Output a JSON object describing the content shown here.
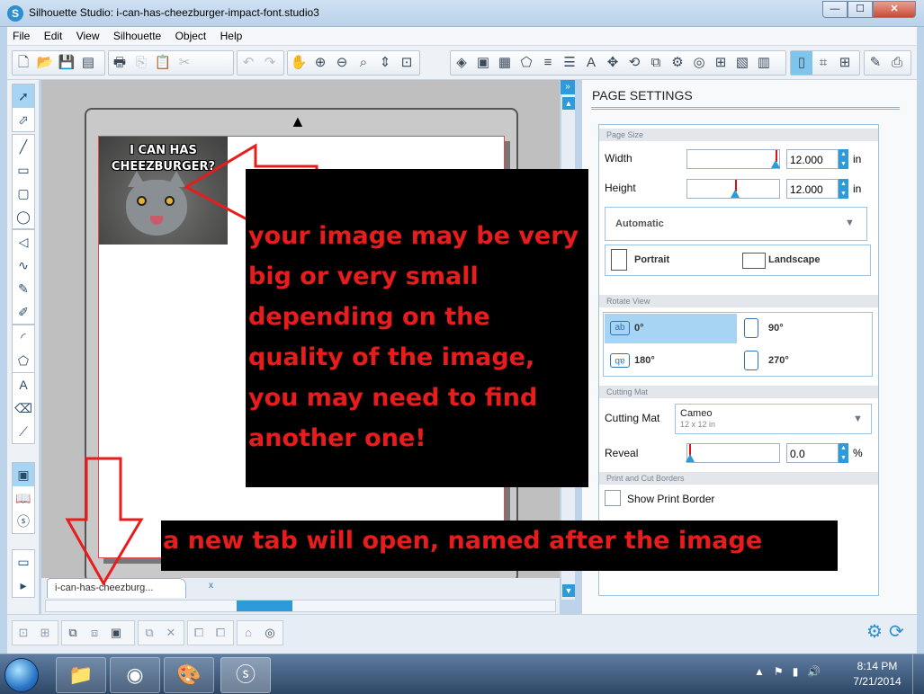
{
  "window": {
    "title": "Silhouette Studio: i-can-has-cheezburger-impact-font.studio3",
    "app_icon_letter": "S",
    "min_label": "—",
    "max_label": "☐",
    "close_label": "✕"
  },
  "menu": [
    "File",
    "Edit",
    "View",
    "Silhouette",
    "Object",
    "Help"
  ],
  "canvas": {
    "meme_text_line1": "I CAN HAS",
    "meme_text_line2": "CHEEZBURGER?"
  },
  "tab": {
    "label": "i-can-has-cheezburg...",
    "close": "x"
  },
  "panel": {
    "collapse_label": "»",
    "title": "PAGE SETTINGS",
    "page_size_head": "Page Size",
    "width_label": "Width",
    "width_value": "12.000",
    "width_unit": "in",
    "height_label": "Height",
    "height_value": "12.000",
    "height_unit": "in",
    "size_dropdown": "Automatic",
    "portrait": "Portrait",
    "landscape": "Landscape",
    "rotate_head": "Rotate View",
    "rotations": [
      "0°",
      "90°",
      "180°",
      "270°"
    ],
    "rotation_glyph": "ab",
    "cutting_mat_head": "Cutting Mat",
    "cutting_mat_label": "Cutting Mat",
    "cutting_mat_value": "Cameo",
    "cutting_mat_size": "12 x 12 in",
    "reveal_label": "Reveal",
    "reveal_value": "0.0",
    "reveal_unit": "%",
    "print_cut_head": "Print and Cut Borders",
    "show_print_border": "Show Print Border"
  },
  "annotations": {
    "image_note_lines": [
      "your image may be very",
      "big or very small",
      "depending on the",
      "quality of the image,",
      "you may need to find",
      "another one!"
    ],
    "tab_note": "a new tab will open, named after the image"
  },
  "taskbar": {
    "time": "8:14 PM",
    "date": "7/21/2014"
  },
  "colors": {
    "accent": "#2d9ad9",
    "annotation_text": "#e81c1c",
    "annotation_bg": "#000000"
  }
}
